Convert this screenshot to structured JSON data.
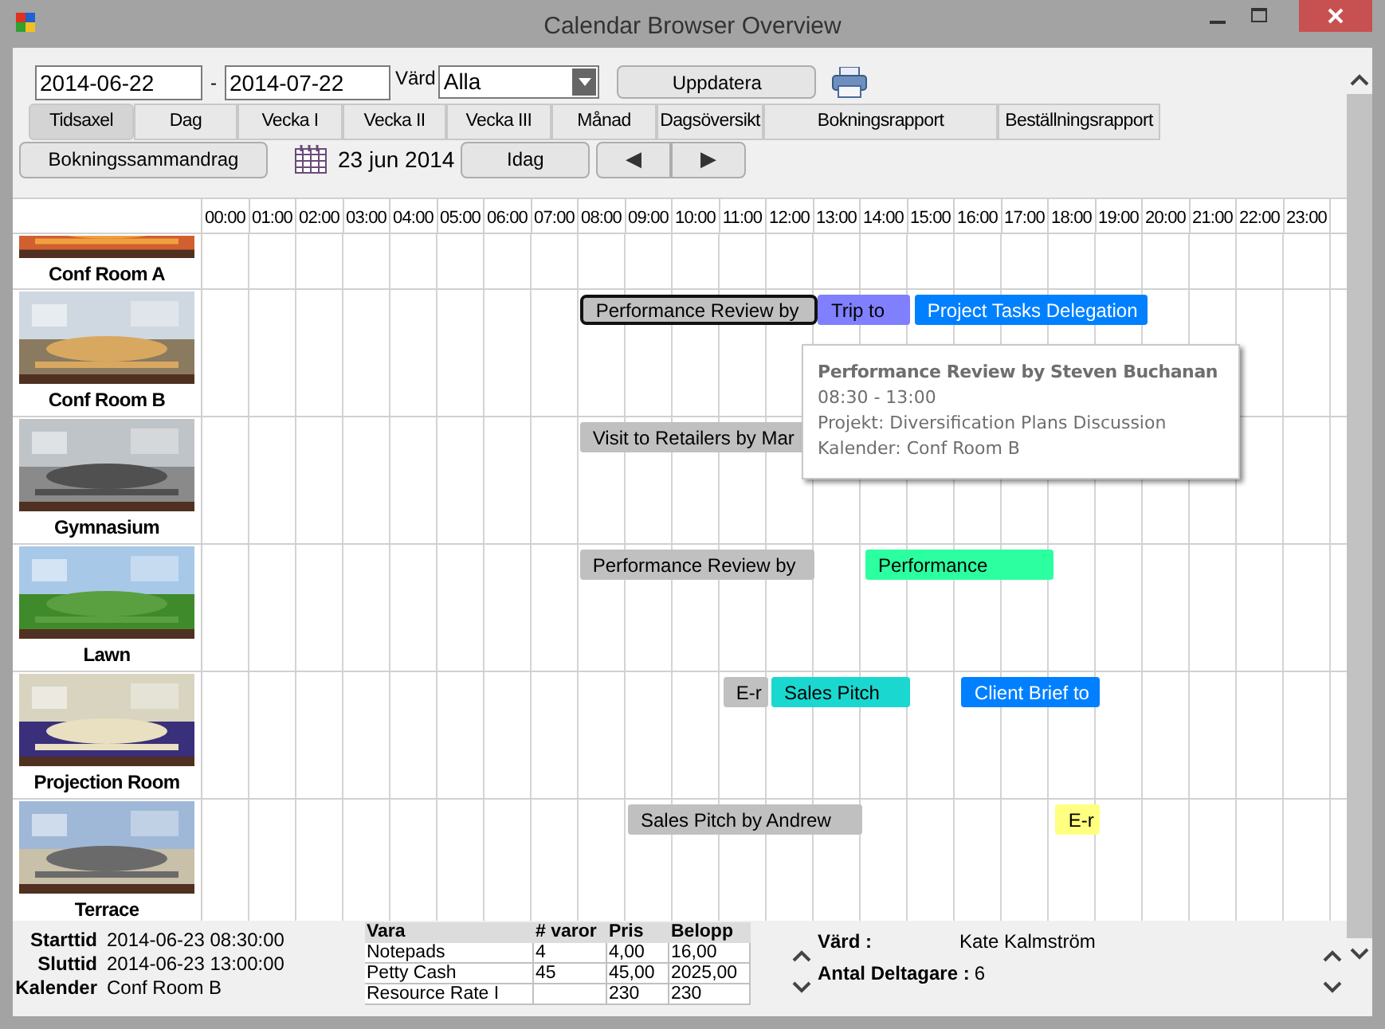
{
  "window": {
    "title": "Calendar Browser Overview"
  },
  "filters": {
    "from_date": "2014-06-22",
    "separator": "-",
    "to_date": "2014-07-22",
    "host_label": "Värd",
    "host_value": "Alla",
    "update_button": "Uppdatera"
  },
  "tabs": [
    {
      "label": "Tidsaxel",
      "selected": true
    },
    {
      "label": "Dag",
      "selected": false
    },
    {
      "label": "Vecka I",
      "selected": false
    },
    {
      "label": "Vecka II",
      "selected": false
    },
    {
      "label": "Vecka III",
      "selected": false
    },
    {
      "label": "Månad",
      "selected": false
    },
    {
      "label": "Dagsöversikt",
      "selected": false
    },
    {
      "label": "Bokningsrapport",
      "selected": false
    },
    {
      "label": "Beställningsrapport",
      "selected": false
    }
  ],
  "navigation": {
    "summary_button": "Bokningssammandrag",
    "current_date": "23 jun 2014",
    "today_button": "Idag",
    "prev_button": "◀",
    "next_button": "▶"
  },
  "timeline": {
    "hours": [
      "00:00",
      "01:00",
      "02:00",
      "03:00",
      "04:00",
      "05:00",
      "06:00",
      "07:00",
      "08:00",
      "09:00",
      "10:00",
      "11:00",
      "12:00",
      "13:00",
      "14:00",
      "15:00",
      "16:00",
      "17:00",
      "18:00",
      "19:00",
      "20:00",
      "21:00",
      "22:00",
      "23:00"
    ],
    "rooms": [
      {
        "name": "Conf Room A"
      },
      {
        "name": "Conf Room B",
        "events": [
          {
            "title": "Performance Review by",
            "color": "#c0c0c0",
            "selected": true
          },
          {
            "title": "Trip to",
            "color": "#8080ff",
            "selected": false
          },
          {
            "title": "Project Tasks Delegation",
            "color": "#0080ff",
            "selected": false
          }
        ]
      },
      {
        "name": "Gymnasium",
        "events": [
          {
            "title": "Visit to Retailers by Mar",
            "color": "#c0c0c0",
            "selected": false
          }
        ]
      },
      {
        "name": "Lawn",
        "events": [
          {
            "title": "Performance Review by",
            "color": "#c0c0c0",
            "selected": false
          },
          {
            "title": "Performance",
            "color": "#2bff9f",
            "selected": false
          }
        ]
      },
      {
        "name": "Projection Room",
        "events": [
          {
            "title": "E-r",
            "color": "#c0c0c0",
            "selected": false
          },
          {
            "title": "Sales Pitch",
            "color": "#1ad8d0",
            "selected": false
          },
          {
            "title": "Client Brief to",
            "color": "#0080ff",
            "selected": false
          }
        ]
      },
      {
        "name": "Terrace",
        "events": [
          {
            "title": "Sales Pitch by Andrew",
            "color": "#c0c0c0",
            "selected": false
          },
          {
            "title": "E-r",
            "color": "#ffff80",
            "selected": false
          }
        ]
      }
    ]
  },
  "tooltip": {
    "title": "Performance Review by Steven Buchanan",
    "time": "08:30 - 13:00",
    "project": "Projekt: Diversification Plans Discussion",
    "calendar": "Kalender: Conf Room B"
  },
  "details": {
    "fields": [
      {
        "label": "Starttid",
        "value": "2014-06-23 08:30:00"
      },
      {
        "label": "Sluttid",
        "value": "2014-06-23 13:00:00"
      },
      {
        "label": "Kalender",
        "value": "Conf Room B"
      }
    ],
    "items": {
      "columns": [
        "Vara",
        "# varor",
        "Pris",
        "Belopp"
      ],
      "rows": [
        [
          "Notepads",
          "4",
          "4,00",
          "16,00"
        ],
        [
          "Petty Cash",
          "45",
          "45,00",
          "2025,00"
        ],
        [
          "Resource Rate I",
          "",
          "230",
          "230"
        ]
      ]
    },
    "host_label": "Värd :",
    "host": "Kate Kalmström",
    "attendees_label": "Antal Deltagare :",
    "attendees": "6"
  }
}
